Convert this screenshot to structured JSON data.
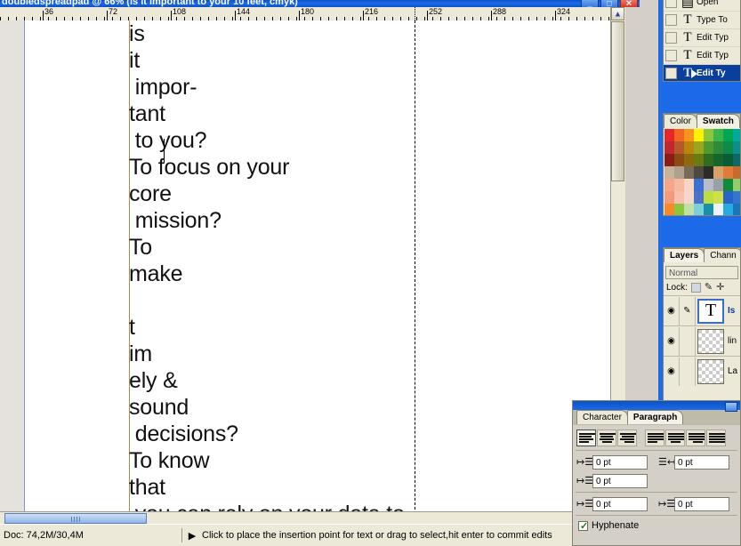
{
  "window": {
    "title": "doubledspreadpad @ 66% (is it important to your 10 feet, cmyk)",
    "minimize_label": "_",
    "maximize_label": "□",
    "close_label": "✕"
  },
  "ruler": {
    "unit": "pt",
    "labels": [
      "36",
      "72",
      "108",
      "144",
      "180",
      "216",
      "252",
      "288",
      "324"
    ],
    "guide_position_label": "216"
  },
  "canvas": {
    "lines": [
      "is",
      "it",
      " impor-",
      "tant",
      " to you?",
      "To focus on your",
      "core",
      " mission?",
      "To",
      "make",
      "",
      "t",
      "im",
      "ely &",
      "sound",
      " decisions?",
      "To know",
      "that",
      " you can rely on your data to"
    ]
  },
  "statusbar": {
    "doc_label": "Doc: 74,2M/30,4M",
    "expand_icon": "▶",
    "hint": "Click to place the insertion point for text or drag to select,hit enter to commit edits"
  },
  "history_panel": {
    "rows": [
      {
        "icon": "open-doc-icon",
        "label": "Open",
        "selected": false
      },
      {
        "icon": "type-tool-icon",
        "label": "Type To",
        "selected": false
      },
      {
        "icon": "type-tool-icon",
        "label": "Edit Typ",
        "selected": false
      },
      {
        "icon": "type-tool-icon",
        "label": "Edit Typ",
        "selected": false
      },
      {
        "icon": "type-tool-icon",
        "label": "Edit Ty",
        "selected": true
      }
    ]
  },
  "color_panel": {
    "tabs": [
      {
        "label": "Color",
        "active": false
      },
      {
        "label": "Swatch",
        "active": true
      }
    ],
    "swatches": [
      "#e8262a",
      "#f16522",
      "#f7941e",
      "#fff200",
      "#8cc63f",
      "#39b54a",
      "#00a651",
      "#00a99d",
      "#c1272d",
      "#b5592a",
      "#b8860b",
      "#9aa61c",
      "#4e9a2c",
      "#2e8b3a",
      "#0e8a4a",
      "#0a8f8a",
      "#8c1c16",
      "#8a4a12",
      "#8a6a0c",
      "#6d7a12",
      "#2f6d22",
      "#15662d",
      "#0a5c36",
      "#0a6b66",
      "#c7b299",
      "#b0a08e",
      "#7a6a5a",
      "#4d4a42",
      "#2b2b28",
      "#d9a06a",
      "#e07b39",
      "#c96a2b",
      "#f4a58a",
      "#f7b8a0",
      "#fbd5c3",
      "#3b6fd4",
      "#b8bcc4",
      "#9aa0a8",
      "#118a3a",
      "#8ecf6a",
      "#f49a7a",
      "#f7c0ae",
      "#f6d7cb",
      "#4a73c8",
      "#bede3b",
      "#cfe04a",
      "#2a63c8",
      "#2f77d0",
      "#f58a2a",
      "#8cc63f",
      "#bfe0a8",
      "#7fd0d6",
      "#1a8fa8",
      "#e9f3f8",
      "#29abe2",
      "#1b75bb",
      "#203864",
      "#16305a",
      "#ece9d8",
      "#ece9d8",
      "#ece9d8",
      "#ece9d8",
      "#ece9d8",
      "#ece9d8"
    ]
  },
  "layers_panel": {
    "tabs": [
      {
        "label": "Layers",
        "active": true
      },
      {
        "label": "Chann",
        "active": false
      }
    ],
    "blend_mode": "Normal",
    "lock_label": "Lock:",
    "lock_icons": [
      "lock-transparent-icon",
      "lock-pixels-icon",
      "lock-position-icon"
    ],
    "rows": [
      {
        "name": "Is",
        "thumb": "text-layer-icon",
        "selected": true,
        "visible": true,
        "has_brush": true
      },
      {
        "name": "lin",
        "thumb": "transparent-thumb",
        "selected": false,
        "visible": true,
        "has_brush": false
      },
      {
        "name": "La",
        "thumb": "transparent-thumb",
        "selected": false,
        "visible": true,
        "has_brush": false
      }
    ]
  },
  "paragraph_panel": {
    "tabs": [
      {
        "label": "Character",
        "active": false
      },
      {
        "label": "Paragraph",
        "active": true
      }
    ],
    "align_buttons": [
      "align-left",
      "align-center",
      "align-right",
      "justify-last-left",
      "justify-last-center",
      "justify-last-right",
      "justify-all"
    ],
    "fields": [
      {
        "icon": "indent-left-icon",
        "value": "0 pt"
      },
      {
        "icon": "indent-right-icon",
        "value": "0 pt"
      },
      {
        "icon": "indent-first-line-icon",
        "value": "0 pt"
      },
      {
        "icon": "space-before-icon",
        "value": "0 pt"
      },
      {
        "icon": "space-after-icon",
        "value": "0 pt"
      }
    ],
    "hyphenate_label": "Hyphenate",
    "hyphenate_checked": true,
    "check_glyph": "✓"
  }
}
